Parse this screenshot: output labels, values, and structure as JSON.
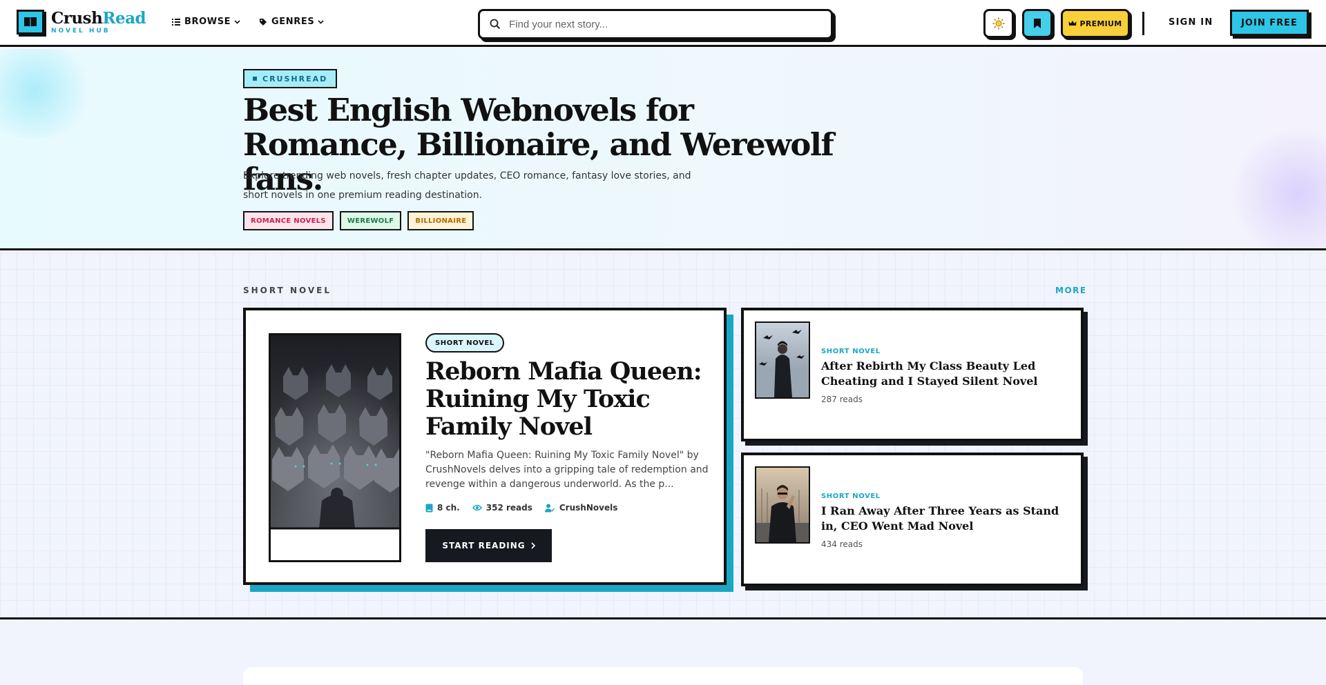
{
  "header": {
    "logo": {
      "title_main": "Crush",
      "title_accent": "Read",
      "subtitle": "NOVEL HUB"
    },
    "nav": {
      "browse": "BROWSE",
      "genres": "GENRES"
    },
    "search": {
      "placeholder": "Find your next story..."
    },
    "premium": "PREMIUM",
    "sign_in": "SIGN IN",
    "join": "JOIN FREE"
  },
  "hero": {
    "badge": "CRUSHREAD",
    "title": "Best English Webnovels for Romance, Billionaire, and Werewolf fans.",
    "description": "Explore trending web novels, fresh chapter updates, CEO romance, fantasy love stories, and short novels in one premium reading destination.",
    "tags": [
      "ROMANCE NOVELS",
      "WEREWOLF",
      "BILLIONAIRE"
    ]
  },
  "section": {
    "title": "SHORT NOVEL",
    "more": "MORE",
    "featured": {
      "badge": "SHORT NOVEL",
      "title": "Reborn Mafia Queen: Ruining My Toxic Family Novel",
      "description": "\"Reborn Mafia Queen: Ruining My Toxic Family Novel\" by CrushNovels delves into a gripping tale of redemption and revenge within a dangerous underworld. As the p...",
      "chapters": "8 ch.",
      "reads": "352 reads",
      "author": "CrushNovels",
      "cta": "START READING"
    },
    "cards": [
      {
        "genre": "SHORT NOVEL",
        "title": "After Rebirth My Class Beauty Led Cheating and I Stayed Silent Novel",
        "reads": "287 reads"
      },
      {
        "genre": "SHORT NOVEL",
        "title": "I Ran Away After Three Years as Stand in, CEO Went Mad Novel",
        "reads": "434 reads"
      }
    ]
  },
  "colors": {
    "accent": "#2ec6e6",
    "accent_dark": "#1ba6c4",
    "premium": "#f9cf3a",
    "ink": "#111111"
  }
}
